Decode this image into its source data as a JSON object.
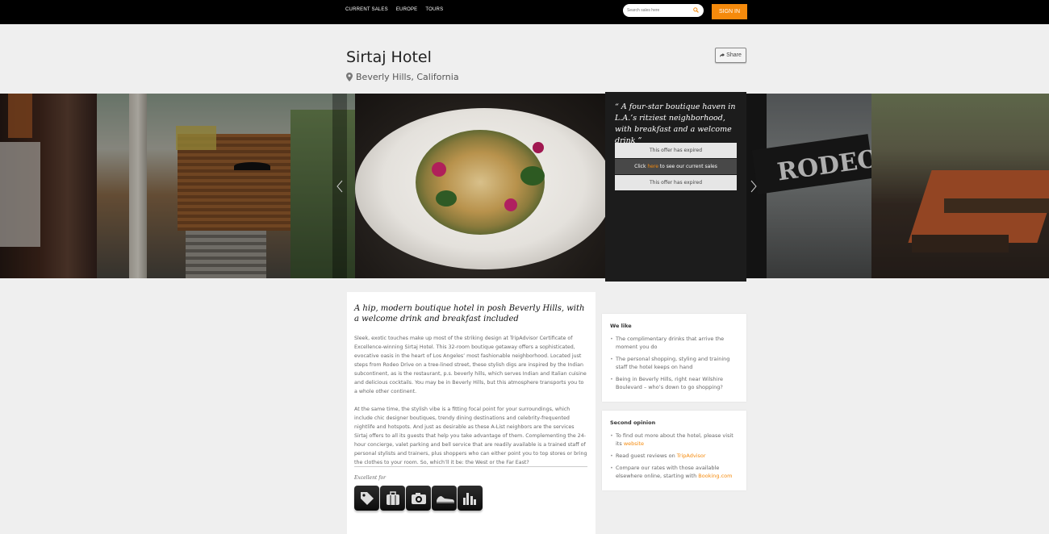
{
  "nav": {
    "links": [
      "CURRENT SALES",
      "EUROPE",
      "TOURS"
    ],
    "search_placeholder": "Search sales here",
    "signin_label": "SIGN IN"
  },
  "hotel": {
    "title": "Sirtaj Hotel",
    "location": "Beverly Hills, California",
    "share_label": "Share"
  },
  "offer": {
    "quote": "“ A four-star boutique haven in L.A.’s ritziest neighborhood, with breakfast and a welcome drink ”",
    "expired_1": "This offer has expired",
    "click_prefix": "Click ",
    "click_link": "here",
    "click_suffix": " to see our current sales",
    "expired_2": "This offer has expired"
  },
  "main": {
    "headline": "A hip, modern boutique hotel in posh Beverly Hills, with a welcome drink and breakfast included",
    "paragraph_1": "Sleek, exotic touches make up most of the striking design at TripAdvisor Certificate of Excellence-winning Sirtaj Hotel. This 32-room boutique getaway offers a sophisticated, evocative oasis in the heart of Los Angeles’ most fashionable neighborhood. Located just steps from Rodeo Drive on a tree-lined street, these stylish digs are inspired by the Indian subcontinent, as is the restaurant, p.s. beverly hills, which serves Indian and Italian cuisine and delicious cocktails. You may be in Beverly Hills, but this atmosphere transports you to a whole other continent.",
    "paragraph_2": "At the same time, the stylish vibe is a fitting focal point for your surroundings, which include chic designer boutiques, trendy dining destinations and celebrity-frequented nightlife and hotspots. And just as desirable as these A-List neighbors are the services Sirtaj offers to all its guests that help you take advantage of them. Complementing the 24-hour concierge, valet parking and bell service that are readily available is a trained staff of personal stylists and trainers, plus shoppers who can either point you to top stores or bring the clothes to your room. So, which’ll it be: the West or the Far East?",
    "excellent_for": "Excellent for",
    "icons": [
      "shopping-tag-icon",
      "luggage-icon",
      "camera-icon",
      "sneakers-icon",
      "city-skyline-icon"
    ]
  },
  "we_like": {
    "heading": "We like",
    "items": [
      "The complimentary drinks that arrive the moment you do",
      "The personal shopping, styling and training staff the hotel keeps on hand",
      "Being in Beverly Hills, right near Wilshire Boulevard – who’s down to go shopping?"
    ]
  },
  "second_opinion": {
    "heading": "Second opinion",
    "item1_prefix": "To find out more about the hotel, please visit its ",
    "item1_link": "website",
    "item2_prefix": "Read guest reviews on ",
    "item2_link": "TripAdvisor",
    "item3_prefix": "Compare our rates with those available elsewhere online, starting with ",
    "item3_link": "Booking.com"
  },
  "colors": {
    "accent": "#f58a0c",
    "topbar": "#000000",
    "offer_bg": "#1c1c1c"
  }
}
